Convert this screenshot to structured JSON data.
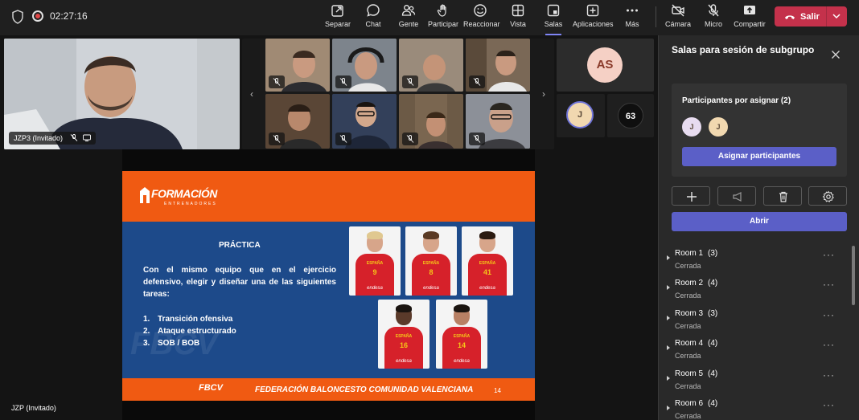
{
  "topbar": {
    "timer": "02:27:16",
    "buttons": [
      {
        "label": "Separar",
        "icon": "pop-out-icon"
      },
      {
        "label": "Chat",
        "icon": "chat-icon"
      },
      {
        "label": "Gente",
        "icon": "people-icon"
      },
      {
        "label": "Participar",
        "icon": "raise-hand-icon"
      },
      {
        "label": "Reaccionar",
        "icon": "react-icon"
      },
      {
        "label": "Vista",
        "icon": "view-icon"
      },
      {
        "label": "Salas",
        "icon": "rooms-icon",
        "active": true
      },
      {
        "label": "Aplicaciones",
        "icon": "apps-icon"
      },
      {
        "label": "Más",
        "icon": "more-icon"
      }
    ],
    "media": [
      {
        "label": "Cámara",
        "icon": "camera-off-icon"
      },
      {
        "label": "Micro",
        "icon": "mic-off-icon"
      },
      {
        "label": "Compartir",
        "icon": "share-icon"
      }
    ],
    "leave_label": "Salir",
    "leave_color": "#c4314b",
    "accent_color": "#5b5fc7"
  },
  "stage": {
    "main_video_name": "JZP3 (Invitado)",
    "presenter_name": "JZP (Invitado)",
    "avatar_initials": "AS",
    "small_avatar_initials": "J",
    "overflow_count": "63"
  },
  "slide": {
    "brand": "FORMACIÓN",
    "brand_sub": "ENTRENADORES",
    "title": "PRÁCTICA",
    "body": "Con el mismo equipo que en el ejercicio defensivo, elegir y diseñar una de las siguientes tareas:",
    "tasks": [
      {
        "n": "1.",
        "text": "Transición ofensiva"
      },
      {
        "n": "2.",
        "text": "Ataque estructurado"
      },
      {
        "n": "3.",
        "text": "SOB / BOB"
      }
    ],
    "players": [
      {
        "number": "9",
        "jersey": "ESPAÑA",
        "sponsor": "endesa"
      },
      {
        "number": "8",
        "jersey": "ESPAÑA",
        "sponsor": "endesa"
      },
      {
        "number": "41",
        "jersey": "ESPAÑA",
        "sponsor": "endesa"
      },
      {
        "number": "16",
        "jersey": "ESPAÑA",
        "sponsor": "endesa"
      },
      {
        "number": "14",
        "jersey": "ESPAÑA",
        "sponsor": "endesa"
      }
    ],
    "watermark": "FBCV",
    "footer_logo": "FBCV",
    "footer_text": "FEDERACIÓN BALONCESTO COMUNIDAD VALENCIANA",
    "page_number": "14"
  },
  "panel": {
    "title": "Salas para sesión de subgrupo",
    "unassigned_title": "Participantes por asignar (2)",
    "unassigned_avatars": [
      "J",
      "J"
    ],
    "assign_label": "Asignar participantes",
    "open_label": "Abrir",
    "rooms": [
      {
        "name": "Room 1",
        "count": "(3)",
        "status": "Cerrada"
      },
      {
        "name": "Room 2",
        "count": "(4)",
        "status": "Cerrada"
      },
      {
        "name": "Room 3",
        "count": "(3)",
        "status": "Cerrada"
      },
      {
        "name": "Room 4",
        "count": "(4)",
        "status": "Cerrada"
      },
      {
        "name": "Room 5",
        "count": "(4)",
        "status": "Cerrada"
      },
      {
        "name": "Room 6",
        "count": "(4)",
        "status": "Cerrada"
      }
    ],
    "more_glyph": "···"
  }
}
